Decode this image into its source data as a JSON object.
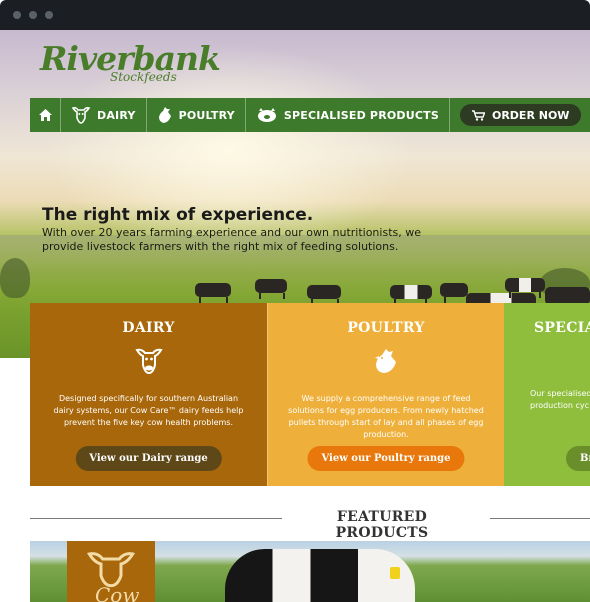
{
  "brand": {
    "name": "Riverbank",
    "subname": "Stockfeeds",
    "green": "#3e7a2c"
  },
  "nav": {
    "items": [
      {
        "label": "DAIRY",
        "icon": "cow-head-icon"
      },
      {
        "label": "POULTRY",
        "icon": "chicken-icon"
      },
      {
        "label": "SPECIALISED PRODUCTS",
        "icon": "pig-icon"
      }
    ],
    "order_label": "ORDER NOW",
    "home_icon": "home-icon",
    "cart_icon": "cart-icon"
  },
  "hero": {
    "headline": "The right mix of experience.",
    "intro": "With over 20 years farming experience and our own nutritionists, we provide livestock farmers with the right mix of feeding solutions."
  },
  "cards": [
    {
      "title": "DAIRY",
      "icon": "cow-head-icon",
      "description": "Designed specifically for southern Australian dairy systems, our Cow Care™ dairy feeds help prevent the five key cow health problems.",
      "button": "View our Dairy range",
      "color": "#a8670a"
    },
    {
      "title": "POULTRY",
      "icon": "chicken-icon",
      "description": "We supply a comprehensive range of feed solutions for egg producers. From newly hatched pullets through start of lay and all phases of egg production.",
      "button": "View our Poultry range",
      "color": "#eeb03a"
    },
    {
      "title": "SPECIA",
      "description_line1": "Our specialised",
      "description_line2": "production cyc",
      "button": "Bro",
      "color": "#8fbe3c"
    }
  ],
  "featured": {
    "heading": "FEATURED PRODUCTS",
    "banner_badge_text": "Cow"
  }
}
